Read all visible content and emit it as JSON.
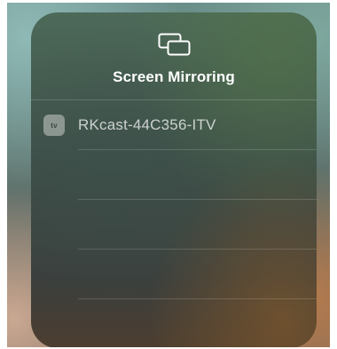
{
  "panel": {
    "title": "Screen Mirroring",
    "header_icon": "screen-mirroring-icon"
  },
  "devices": [
    {
      "name": "RKcast-44C356-ITV",
      "badge_text": "tv",
      "badge_icon": "apple-tv-icon"
    }
  ],
  "colors": {
    "title_text": "#ffffff",
    "device_text": "#d0d6d3"
  }
}
